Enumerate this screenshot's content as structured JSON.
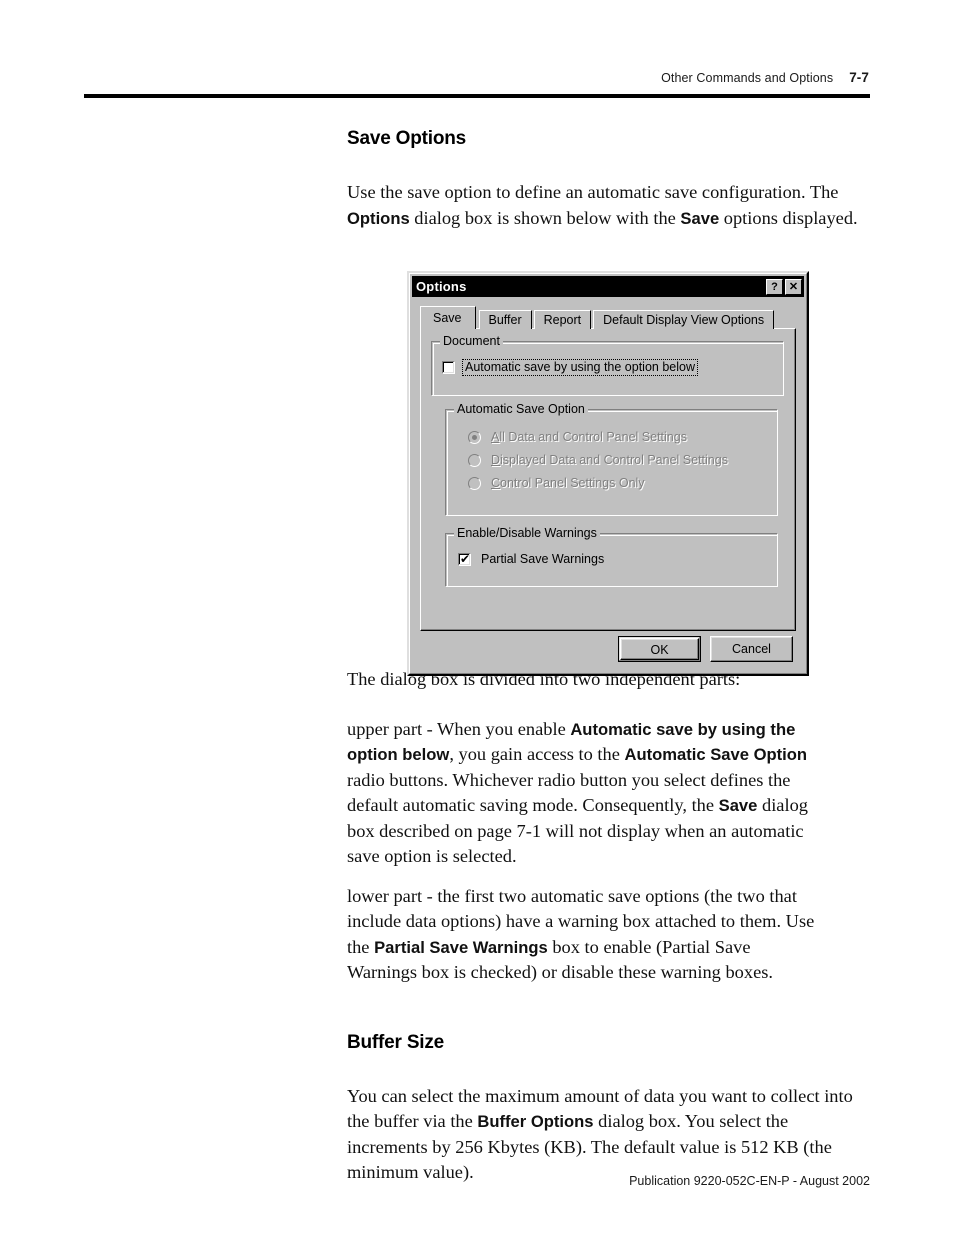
{
  "page": {
    "header_title": "Other Commands and Options",
    "page_number": "7-7",
    "footer": "Publication 9220-052C-EN-P - August 2002"
  },
  "sections": {
    "save_options": {
      "title": "Save Options",
      "intro_1": "Use the save option to define an automatic save configuration. The ",
      "intro_bold_1": "Options",
      "intro_2": " dialog box is shown below with the ",
      "intro_bold_2": "Save",
      "intro_3": " options displayed.",
      "divided_line": "The dialog box is divided into two independent parts:",
      "upper_1": "upper part - When you enable ",
      "upper_bold_1": "Automatic save by using the option below",
      "upper_2": ", you gain access to the ",
      "upper_bold_2": "Automatic Save Option",
      "upper_3": " radio buttons. Whichever radio button you select defines the default automatic saving mode. Consequently, the ",
      "upper_bold_3": "Save",
      "upper_4": " dialog box described on page 7-1 will not display when an automatic save option is selected.",
      "lower_1": "lower part - the first two automatic save options (the two that include data options) have a warning box attached to them. Use the ",
      "lower_bold_1": "Partial Save Warnings",
      "lower_2": " box to enable (Partial Save Warnings box is checked) or disable these warning boxes."
    },
    "buffer_size": {
      "title": "Buffer Size",
      "body_1": "You can select the maximum amount of data you want to collect into the buffer via the ",
      "body_bold_1": "Buffer Options",
      "body_2": " dialog box. You select the increments by 256 Kbytes (KB). The default value is 512 KB (the minimum value)."
    }
  },
  "dialog": {
    "title": "Options",
    "help_button": "?",
    "close_button": "✕",
    "tabs": [
      {
        "label": "Save",
        "active": true
      },
      {
        "label": "Buffer",
        "active": false
      },
      {
        "label": "Report",
        "active": false
      },
      {
        "label": "Default Display View Options",
        "active": false
      }
    ],
    "document_group": {
      "title": "Document",
      "checkbox_label": "Automatic save by using the option below",
      "checked": false,
      "focused": true
    },
    "automatic_save_group": {
      "title": "Automatic Save Option",
      "disabled": true,
      "options": [
        {
          "label": "All Data and Control Panel Settings",
          "mnemonic": "A",
          "selected": true
        },
        {
          "label": "Displayed Data and Control Panel Settings",
          "mnemonic": "D",
          "selected": false
        },
        {
          "label": "Control Panel Settings Only",
          "mnemonic": "C",
          "selected": false
        }
      ]
    },
    "warnings_group": {
      "title": "Enable/Disable Warnings",
      "checkbox_label": "Partial Save Warnings",
      "checked": true,
      "check_glyph": "✔"
    },
    "buttons": {
      "ok": "OK",
      "cancel": "Cancel"
    }
  },
  "colors": {
    "dialog_face": "#c0c0c0",
    "titlebar": "#000000",
    "disabled_text": "#808080"
  }
}
